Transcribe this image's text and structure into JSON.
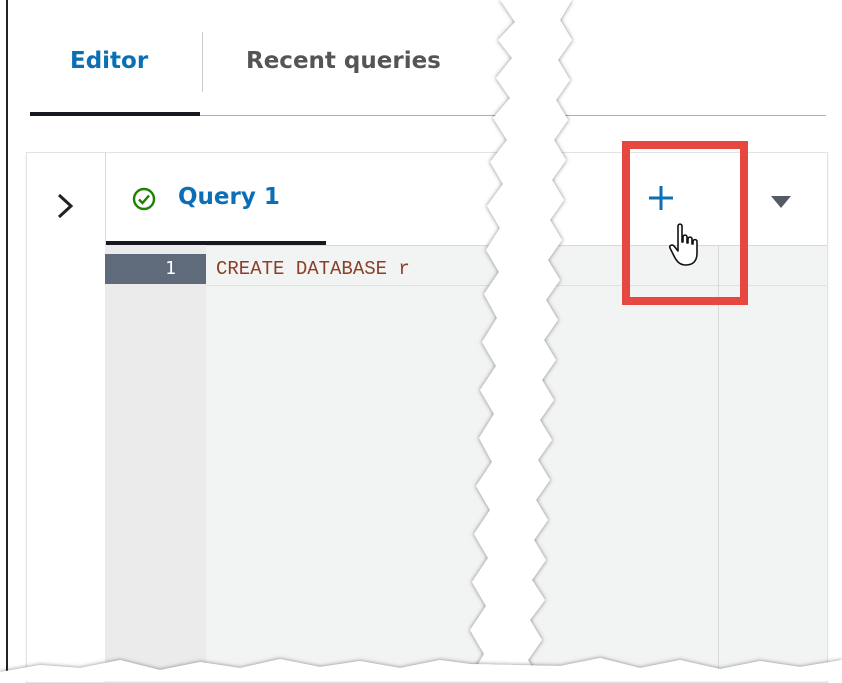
{
  "tabs": [
    {
      "label": "Editor",
      "active": true
    },
    {
      "label": "Recent queries",
      "active": false
    }
  ],
  "query_tab": {
    "label": "Query 1",
    "status_icon": "check-circle-icon"
  },
  "editor": {
    "line_number": "1",
    "code": "CREATE DATABASE r"
  },
  "icons": {
    "expand": "chevron-right-icon",
    "new_query": "plus-icon",
    "menu": "caret-down-icon",
    "cursor": "hand-pointer-icon"
  },
  "colors": {
    "accent": "#0b6fb6",
    "highlight": "#e8473f",
    "success": "#1d8102",
    "code_keyword": "#8b3f2a"
  }
}
